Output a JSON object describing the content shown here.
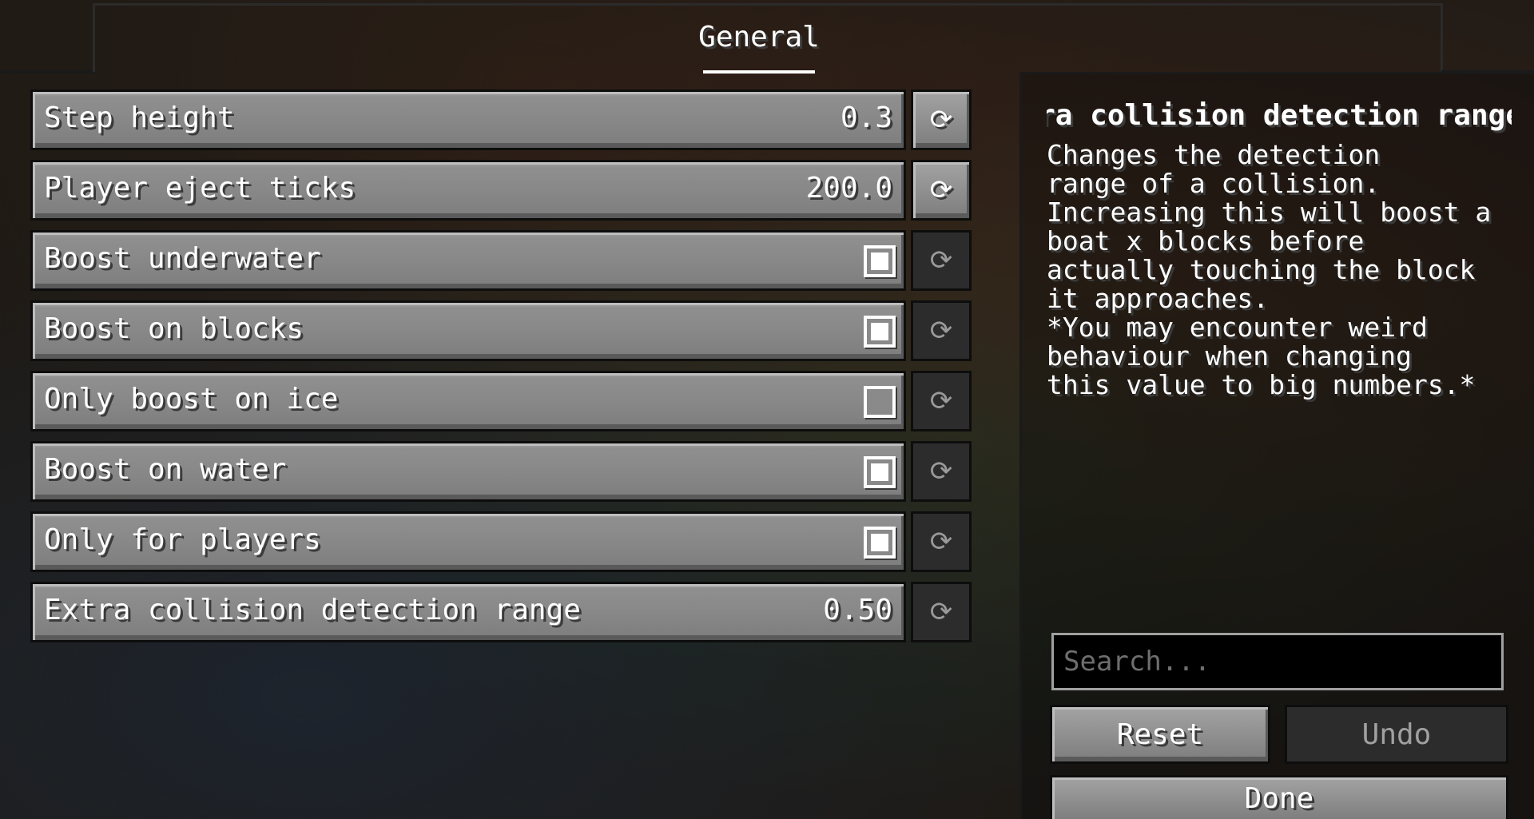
{
  "header": {
    "tab_label": "General"
  },
  "settings": [
    {
      "label": "Step height",
      "type": "value",
      "value": "0.3",
      "reset_enabled": true
    },
    {
      "label": "Player eject ticks",
      "type": "value",
      "value": "200.0",
      "reset_enabled": true
    },
    {
      "label": "Boost underwater",
      "type": "checkbox",
      "checked": true,
      "reset_enabled": false
    },
    {
      "label": "Boost on blocks",
      "type": "checkbox",
      "checked": true,
      "reset_enabled": false
    },
    {
      "label": "Only boost on ice",
      "type": "checkbox",
      "checked": false,
      "reset_enabled": false
    },
    {
      "label": "Boost on water",
      "type": "checkbox",
      "checked": true,
      "reset_enabled": false
    },
    {
      "label": "Only for players",
      "type": "checkbox",
      "checked": true,
      "reset_enabled": false
    },
    {
      "label": "Extra collision detection range",
      "type": "value",
      "value": "0.50",
      "reset_enabled": false
    }
  ],
  "reset_icon": "⟳",
  "description": {
    "title": "Extra collision detection range",
    "body": "Changes the detection\nrange of a collision.\nIncreasing this will boost a\nboat x blocks before\nactually touching the block\nit approaches.\n*You may encounter weird\nbehaviour when changing\nthis value to big numbers.*"
  },
  "search": {
    "placeholder": "Search..."
  },
  "buttons": {
    "reset_label": "Reset",
    "undo_label": "Undo",
    "done_label": "Done"
  },
  "colors": {
    "button_face": "#8f8f8f",
    "disabled_face": "#2c2c2c",
    "text": "#ffffff"
  }
}
